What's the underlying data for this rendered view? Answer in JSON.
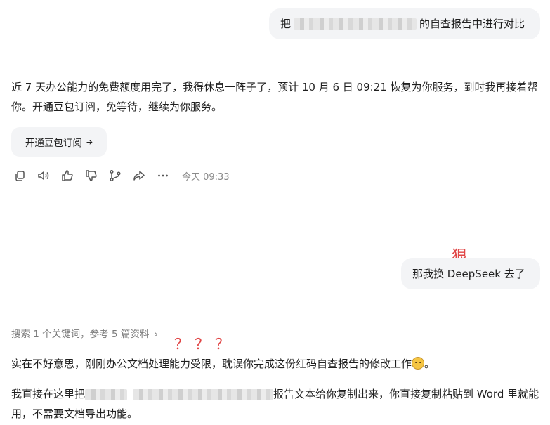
{
  "messages": {
    "user1": {
      "prefix": "把",
      "suffix": "的自查报告中进行对比"
    },
    "ai1": {
      "text": "近 7 天办公能力的免费额度用完了，我得休息一阵子了，预计 10 月 6 日 09:21 恢复为你服务，到时我再接着帮你。开通豆包订阅，免等待，继续为你服务。"
    },
    "cta": {
      "label": "开通豆包订阅",
      "arrow": "➔"
    },
    "actions": {
      "icons": [
        "copy-icon",
        "speaker-icon",
        "thumbs-up-icon",
        "thumbs-down-icon",
        "branch-icon",
        "share-icon",
        "more-icon"
      ],
      "timestamp": "今天 09:33"
    },
    "user2": {
      "text": "那我换 DeepSeek 去了"
    },
    "search_summary": {
      "text": "搜索 1 个关键词，参考 5 篇资料",
      "chevron": "›"
    },
    "ai2": {
      "text": "实在不好意思，刚刚办公文档处理能力受限，耽误你完成这份红码自查报告的修改工作",
      "emoji": "disappointed-face-emoji",
      "end": "。"
    },
    "ai3": {
      "prefix": "我直接在这里把",
      "suffix": "报告文本给你复制出来，你直接复制粘贴到 Word 里就能用，不需要文档导出功能。"
    }
  },
  "annotations": {
    "hen": "狠",
    "questions": "？？？",
    "color": "#e04545"
  }
}
